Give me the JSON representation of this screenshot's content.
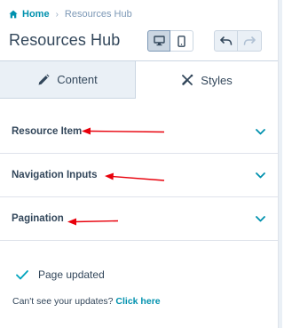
{
  "breadcrumb": {
    "home": "Home",
    "separator": "›",
    "current": "Resources Hub"
  },
  "header": {
    "title": "Resources Hub"
  },
  "toolbar": {
    "desktop_icon": "desktop-icon",
    "mobile_icon": "mobile-icon",
    "undo_icon": "undo-icon",
    "redo_icon": "redo-icon"
  },
  "tabs": [
    {
      "label": "Content",
      "icon": "pencil-icon",
      "active": false
    },
    {
      "label": "Styles",
      "icon": "brush-icon",
      "active": true
    }
  ],
  "sections": [
    {
      "label": "Resource Item"
    },
    {
      "label": "Navigation Inputs"
    },
    {
      "label": "Pagination"
    }
  ],
  "status": {
    "text": "Page updated"
  },
  "help": {
    "question": "Can't see your updates?",
    "link": "Click here"
  },
  "colors": {
    "accent": "#0091ae",
    "text": "#33475b",
    "annotation_arrow": "#e8000b",
    "check": "#00a4bd"
  }
}
